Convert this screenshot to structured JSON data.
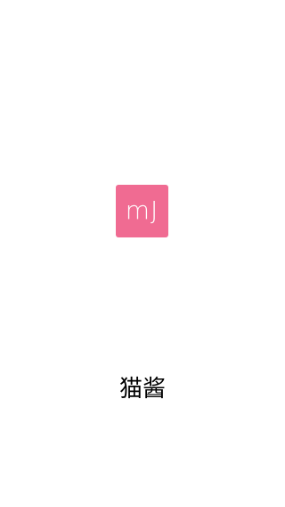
{
  "splash": {
    "logo_text": "mJ",
    "app_name": "猫酱"
  },
  "colors": {
    "background": "#ffffff",
    "logo_background": "#f06b92",
    "logo_text": "#ffffff",
    "app_name_text": "#000000"
  }
}
